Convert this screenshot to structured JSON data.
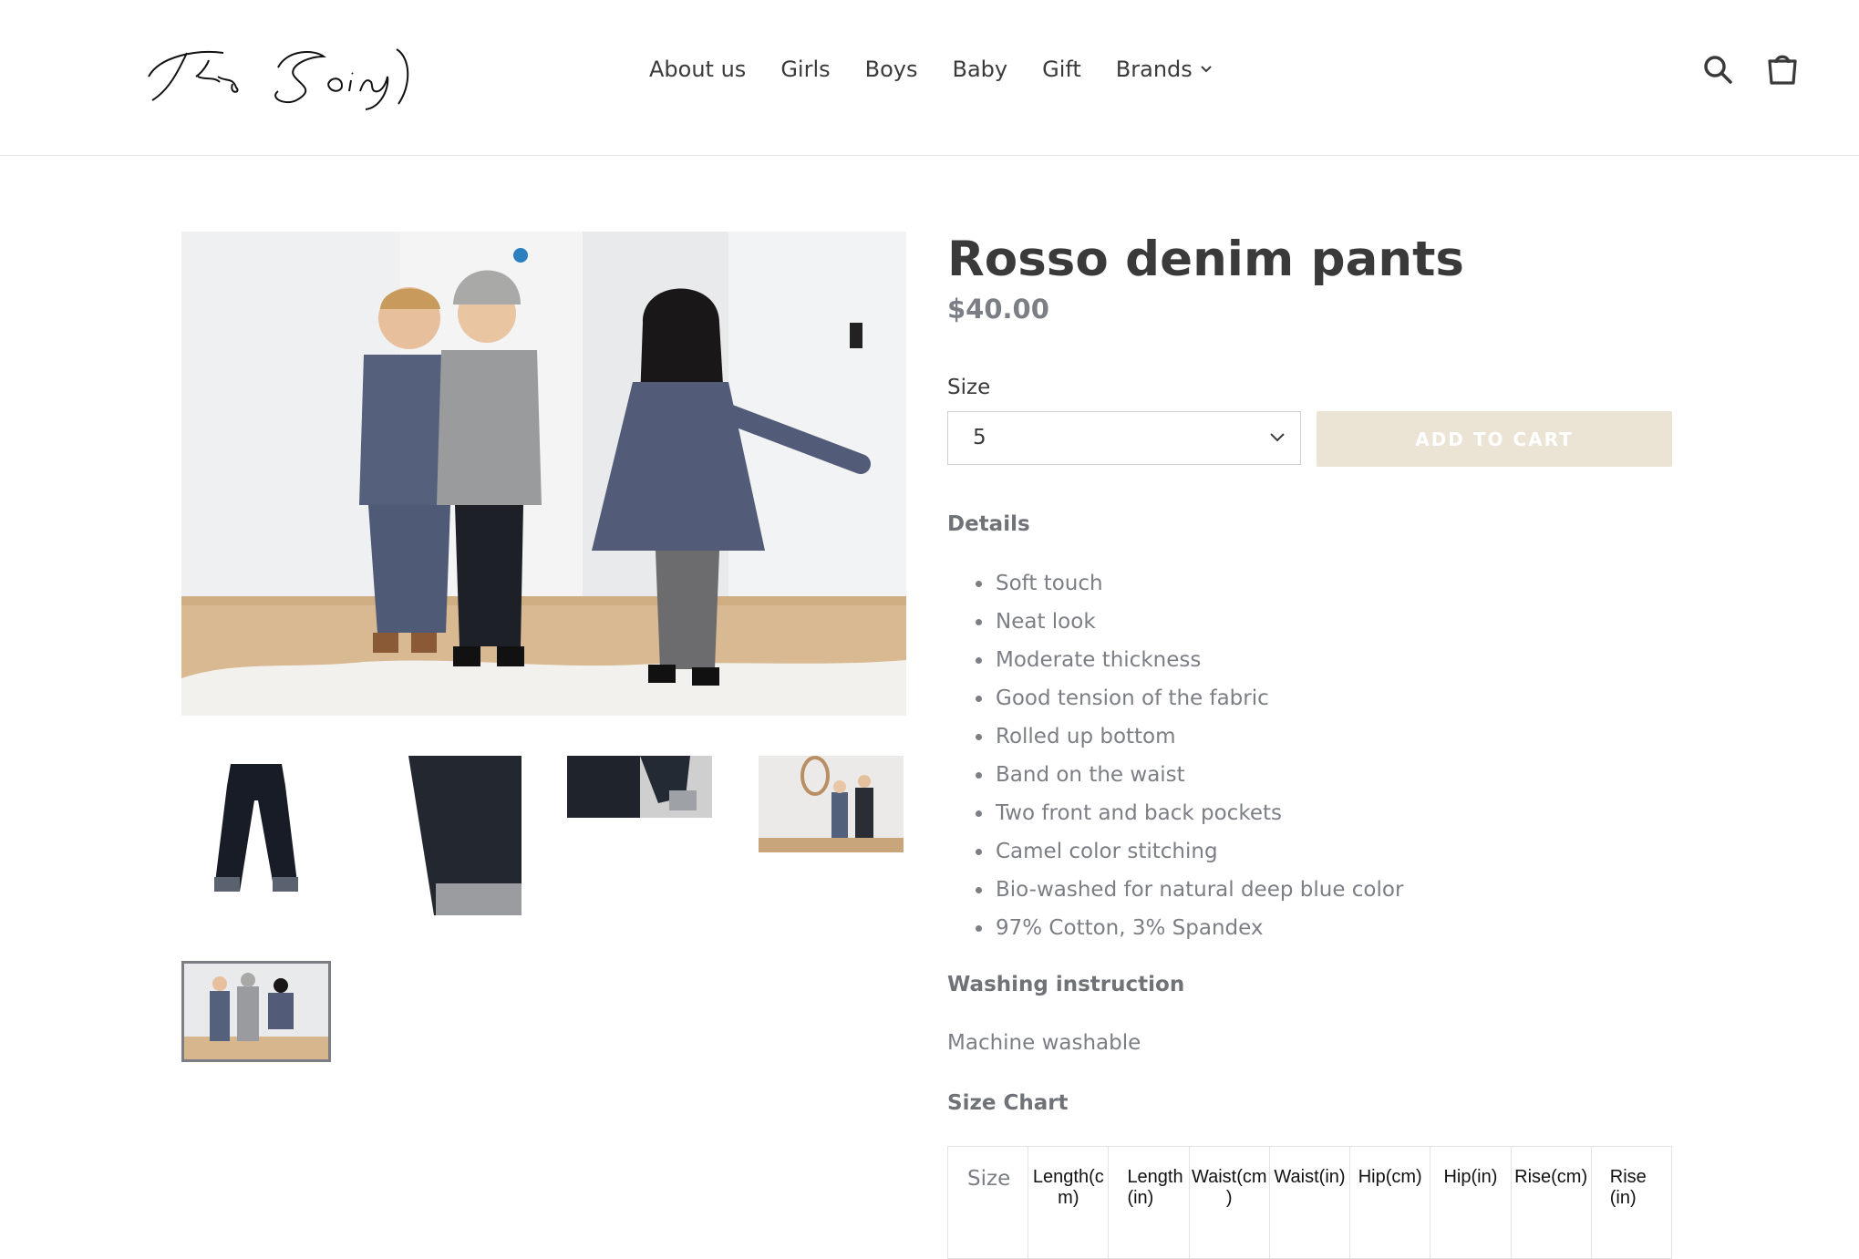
{
  "header": {
    "logo_text": "The Soin",
    "nav": [
      "About us",
      "Girls",
      "Boys",
      "Baby",
      "Gift",
      "Brands"
    ],
    "icons": {
      "search": "search-icon",
      "cart": "cart-icon",
      "dropdown": "chevron-down-icon"
    }
  },
  "product": {
    "title": "Rosso denim pants",
    "price": "$40.00",
    "size_label": "Size",
    "size_selected": "5",
    "add_to_cart": "ADD TO CART"
  },
  "details": {
    "heading": "Details",
    "features": [
      "Soft touch",
      "Neat look",
      "Moderate thickness",
      "Good tension of the fabric",
      "Rolled up bottom",
      "Band on the waist",
      "Two front and back pockets",
      "Camel color stitching",
      "Bio-washed for natural deep blue color",
      "97% Cotton, 3% Spandex"
    ],
    "washing_heading": "Washing instruction",
    "washing_text": "Machine washable",
    "size_chart_heading": "Size Chart",
    "size_chart_headers": [
      "Size",
      "Length(cm)",
      "Length (in)",
      "Waist(cm)",
      "Waist(in)",
      "Hip(cm)",
      "Hip(in)",
      "Rise(cm)",
      "Rise (in)"
    ]
  },
  "colors": {
    "accent_button": "#ebe3d4",
    "text_dark": "#3a3a3a",
    "text_muted": "#7b7f85"
  }
}
